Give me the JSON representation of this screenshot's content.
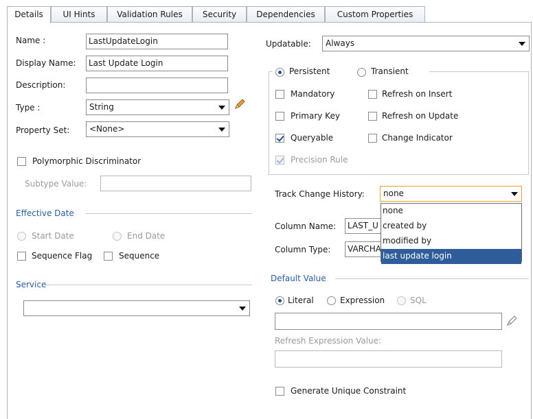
{
  "tabs": [
    "Details",
    "UI Hints",
    "Validation Rules",
    "Security",
    "Dependencies",
    "Custom Properties"
  ],
  "left": {
    "name_label": "Name :",
    "name_value": "LastUpdateLogin",
    "display_name_label": "Display Name:",
    "display_name_value": "Last Update Login",
    "description_label": "Description:",
    "description_value": "",
    "type_label": "Type :",
    "type_value": "String",
    "property_set_label": "Property Set:",
    "property_set_value": "<None>",
    "polymorphic_label": "Polymorphic Discriminator",
    "polymorphic_checked": false,
    "subtype_label": "Subtype Value:",
    "subtype_value": "",
    "effective_date_title": "Effective Date",
    "start_date_label": "Start Date",
    "end_date_label": "End Date",
    "sequence_flag_label": "Sequence Flag",
    "sequence_label": "Sequence",
    "service_title": "Service",
    "service_value": ""
  },
  "right": {
    "updatable_label": "Updatable:",
    "updatable_value": "Always",
    "persistent_label": "Persistent",
    "transient_label": "Transient",
    "mandatory_label": "Mandatory",
    "refresh_insert_label": "Refresh on Insert",
    "primary_key_label": "Primary Key",
    "refresh_update_label": "Refresh on Update",
    "queryable_label": "Queryable",
    "change_indicator_label": "Change Indicator",
    "precision_rule_label": "Precision Rule",
    "track_change_label": "Track Change History:",
    "track_change_value": "none",
    "track_change_options": [
      "none",
      "created by",
      "modified by",
      "last update login"
    ],
    "track_change_highlighted": "last update login",
    "column_name_label": "Column Name:",
    "column_name_value": "LAST_U",
    "column_type_label": "Column Type:",
    "column_type_value": "VARCHA",
    "default_value_title": "Default Value",
    "literal_label": "Literal",
    "expression_label": "Expression",
    "sql_label": "SQL",
    "default_value": "",
    "refresh_expr_label": "Refresh Expression Value:",
    "refresh_expr_value": "",
    "generate_unique_label": "Generate Unique Constraint"
  }
}
